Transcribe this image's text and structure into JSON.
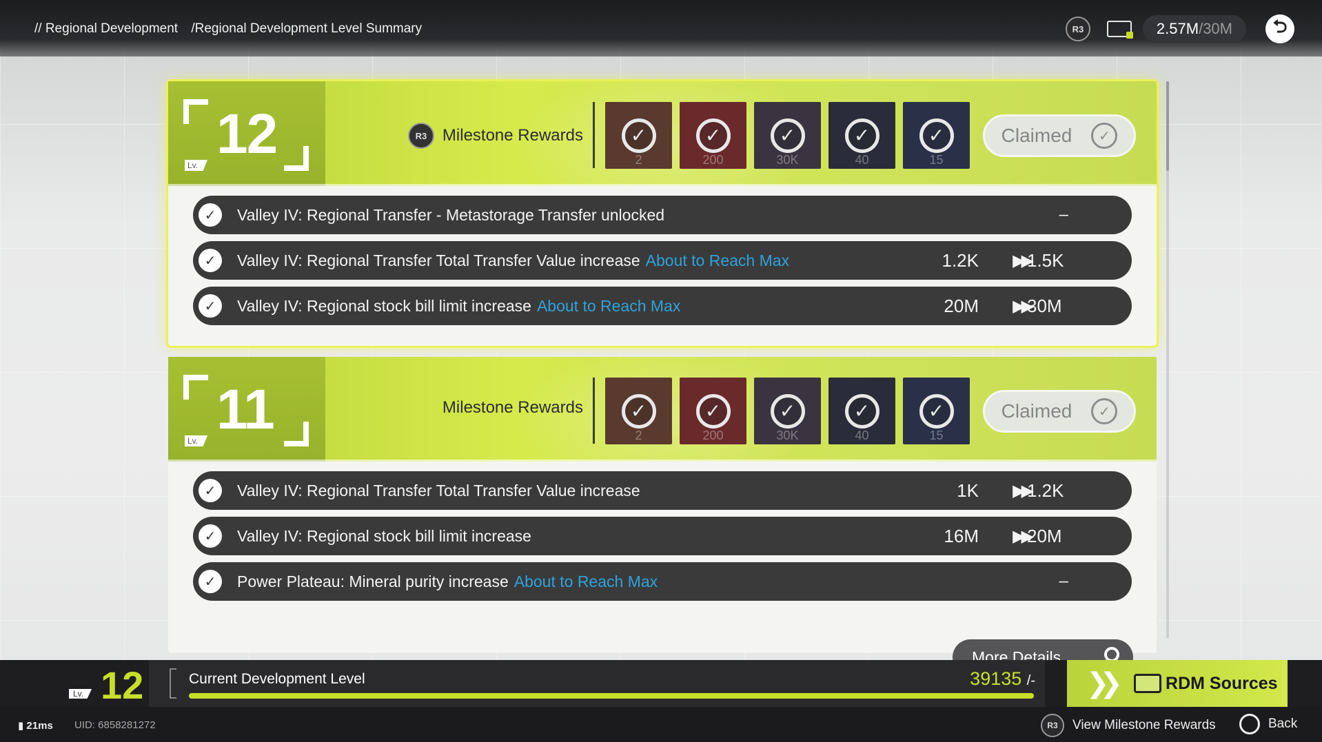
{
  "header": {
    "breadcrumb": [
      "// Regional Development",
      "/Regional Development Level Summary"
    ],
    "r3_label": "R3",
    "bill_icon": "stock-bill-icon",
    "bill_current": "2.57M",
    "bill_max": "/30M",
    "back_icon": "back-arrow-icon"
  },
  "levels": [
    {
      "level": "12",
      "lv_tag": "Lv.",
      "milestone_label": "Milestone Rewards",
      "r3_label": "R3",
      "rewards": [
        {
          "qty": "2",
          "color": "#5a3a2e"
        },
        {
          "qty": "200",
          "color": "#6a2a2c"
        },
        {
          "qty": "30K",
          "color": "#3a3440"
        },
        {
          "qty": "40",
          "color": "#2a2c3a"
        },
        {
          "qty": "15",
          "color": "#2a3048"
        }
      ],
      "claimed_label": "Claimed",
      "rows": [
        {
          "text": "Valley IV: Regional Transfer - Metastorage Transfer unlocked",
          "max_tag": "",
          "from": "",
          "to": "",
          "dash": "–"
        },
        {
          "text": "Valley IV: Regional Transfer Total Transfer Value increase",
          "max_tag": "About to Reach Max",
          "from": "1.2K",
          "to": "1.5K",
          "dash": ""
        },
        {
          "text": "Valley IV: Regional stock bill limit increase",
          "max_tag": "About to Reach Max",
          "from": "20M",
          "to": "30M",
          "dash": ""
        }
      ]
    },
    {
      "level": "11",
      "lv_tag": "Lv.",
      "milestone_label": "Milestone Rewards",
      "rewards": [
        {
          "qty": "2",
          "color": "#5a3a2e"
        },
        {
          "qty": "200",
          "color": "#6a2a2c"
        },
        {
          "qty": "30K",
          "color": "#3a3440"
        },
        {
          "qty": "40",
          "color": "#2a2c3a"
        },
        {
          "qty": "15",
          "color": "#2a3048"
        }
      ],
      "claimed_label": "Claimed",
      "rows": [
        {
          "text": "Valley IV: Regional Transfer Total Transfer Value increase",
          "max_tag": "",
          "from": "1K",
          "to": "1.2K",
          "dash": ""
        },
        {
          "text": "Valley IV: Regional stock bill limit increase",
          "max_tag": "",
          "from": "16M",
          "to": "20M",
          "dash": ""
        },
        {
          "text": "Power Plateau: Mineral purity increase",
          "max_tag": "About to Reach Max",
          "from": "",
          "to": "",
          "dash": "–"
        }
      ],
      "dots": "▪▪▪",
      "more_details_label": "More Details"
    }
  ],
  "dev_bar": {
    "lv_tag": "Lv.",
    "current_level": "12",
    "label": "Current Development Level",
    "value": "39135",
    "max": "/-",
    "progress_fraction": 1.0,
    "rdm_label": "RDM Sources"
  },
  "footer": {
    "ping": "21ms",
    "uid": "UID: 6858281272",
    "r3_label": "R3",
    "view_rewards_label": "View Milestone Rewards",
    "back_label": "Back"
  },
  "colors": {
    "accent_green": "#c6e02a",
    "max_tag_blue": "#2fa3d8",
    "row_dark": "#3a3a3b"
  }
}
